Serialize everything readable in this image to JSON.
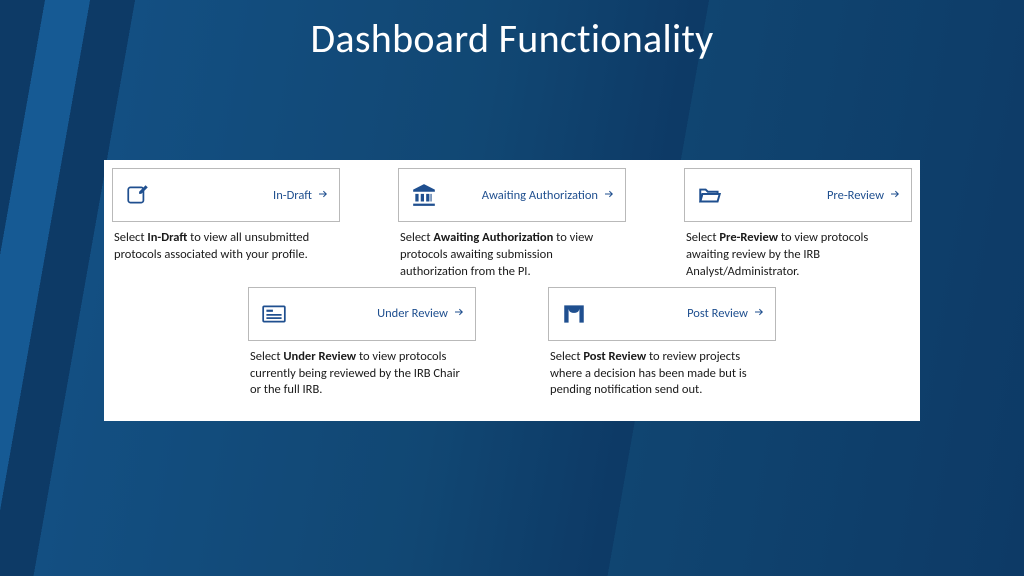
{
  "title": "Dashboard Functionality",
  "tiles": {
    "indraft": {
      "label": "In-Draft",
      "desc_pre": "Select ",
      "desc_bold": "In-Draft",
      "desc_post": " to view all unsubmitted protocols associated with your profile."
    },
    "awaiting": {
      "label": "Awaiting Authorization",
      "desc_pre": "Select ",
      "desc_bold": "Awaiting Authorization",
      "desc_post": " to view protocols awaiting submission authorization from the PI."
    },
    "prereview": {
      "label": "Pre-Review",
      "desc_pre": "Select ",
      "desc_bold": "Pre-Review",
      "desc_post": " to view protocols awaiting review by the IRB Analyst/Administrator."
    },
    "underreview": {
      "label": "Under Review",
      "desc_pre": "Select ",
      "desc_bold": "Under Review",
      "desc_post": " to view protocols currently being reviewed by the IRB Chair or the full IRB."
    },
    "postreview": {
      "label": "Post Review",
      "desc_pre": "Select ",
      "desc_bold": "Post Review",
      "desc_post": " to review projects where a decision has been made but is pending notification send out."
    }
  }
}
